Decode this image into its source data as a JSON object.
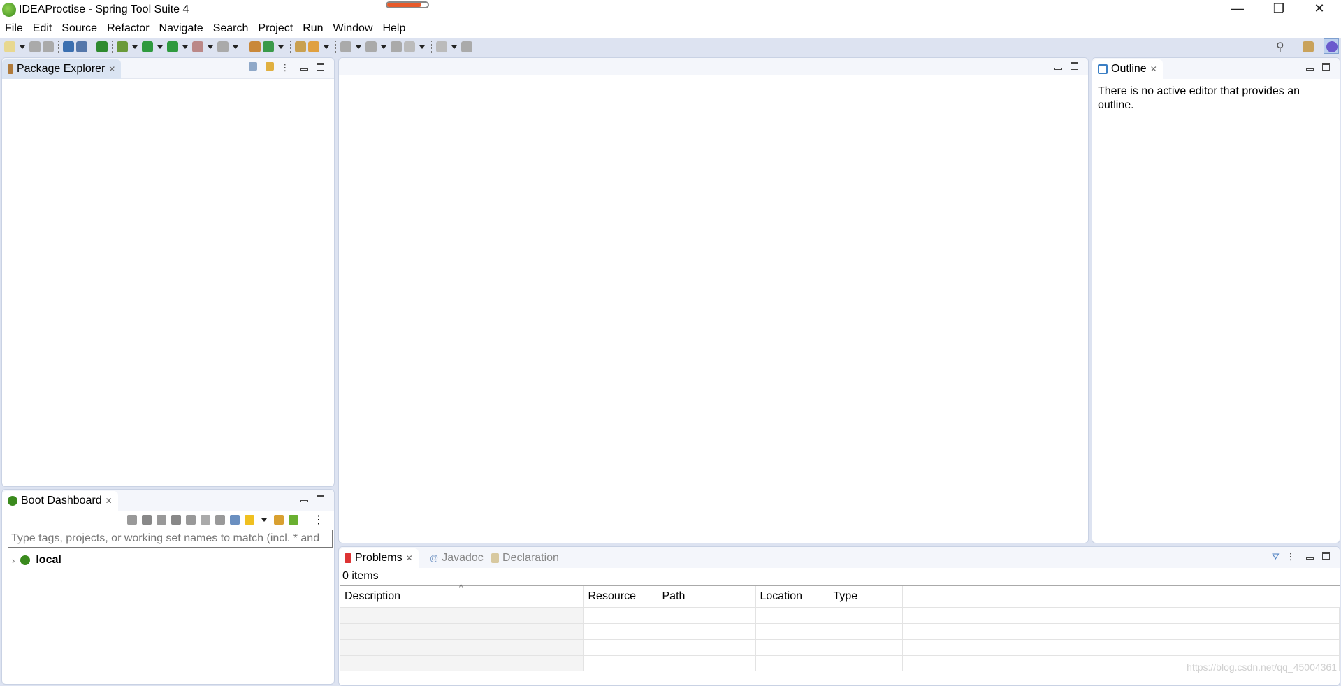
{
  "window": {
    "title": "IDEAProctise - Spring Tool Suite 4",
    "progress_percent": 85,
    "controls": {
      "minimize": "—",
      "restore": "❐",
      "close": "✕"
    }
  },
  "menu": [
    "File",
    "Edit",
    "Source",
    "Refactor",
    "Navigate",
    "Search",
    "Project",
    "Run",
    "Window",
    "Help"
  ],
  "toolbar": {
    "icons": [
      "new-icon",
      "save-icon",
      "save-all-icon",
      "terminal-icon",
      "link-icon",
      "spring-boot-icon",
      "debug-icon",
      "run-icon",
      "run-external-icon",
      "stop-icon",
      "run-last-icon",
      "new-package-icon",
      "new-class-icon",
      "open-type-icon",
      "open-task-icon",
      "next-annotation-icon",
      "prev-annotation-icon",
      "last-edit-icon",
      "back-icon",
      "forward-icon",
      "pin-editor-icon"
    ],
    "right_icons": [
      "search-icon",
      "open-perspective-icon",
      "java-perspective-icon"
    ]
  },
  "package_explorer": {
    "tab": "Package Explorer"
  },
  "boot_dashboard": {
    "tab": "Boot Dashboard",
    "filter_placeholder": "Type tags, projects, or working set names to match (incl. * and",
    "tree": [
      {
        "label": "local",
        "expanded": false
      }
    ]
  },
  "outline": {
    "tab": "Outline",
    "message": "There is no active editor that provides an outline."
  },
  "bottom": {
    "tabs": [
      "Problems",
      "Javadoc",
      "Declaration"
    ],
    "active_tab": "Problems",
    "count": "0 items",
    "columns": [
      "Description",
      "Resource",
      "Path",
      "Location",
      "Type"
    ],
    "sort_indicator": "^"
  },
  "watermark": "https://blog.csdn.net/qq_45004361",
  "colors": {
    "background": "#dde3f1",
    "spring_green": "#3a8a1d",
    "progress": "#e85a2a"
  }
}
